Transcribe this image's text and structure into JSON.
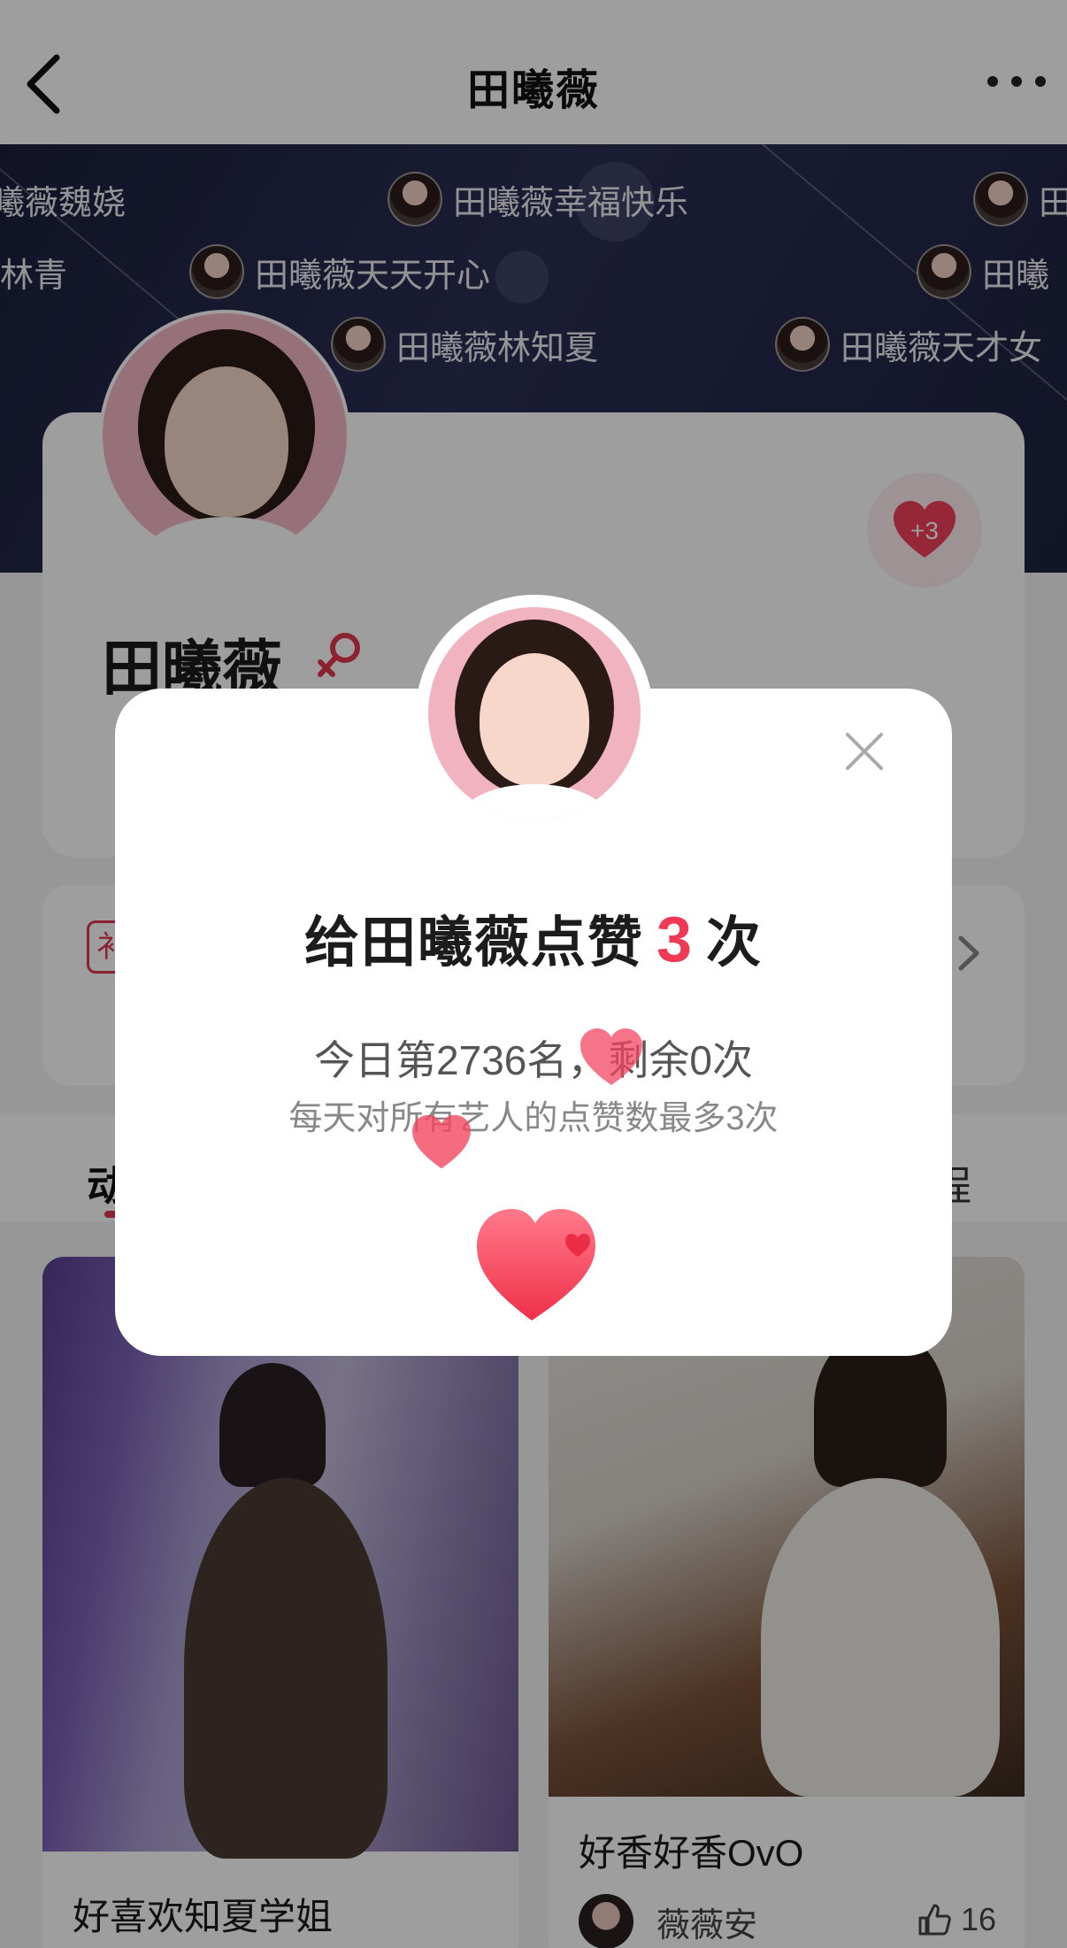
{
  "nav": {
    "title": "田曦薇"
  },
  "banner": {
    "chips": [
      {
        "text": "曦薇魏娆",
        "has_avatar": false
      },
      {
        "text": "田曦薇幸福快乐",
        "has_avatar": true
      },
      {
        "text": "田",
        "has_avatar": true
      },
      {
        "text": "林青",
        "has_avatar": false
      },
      {
        "text": "田曦薇天天开心",
        "has_avatar": true
      },
      {
        "text": "田曦",
        "has_avatar": true
      },
      {
        "text": "田曦薇林知夏",
        "has_avatar": true
      },
      {
        "text": "田曦薇天才女",
        "has_avatar": true
      }
    ]
  },
  "profile": {
    "name": "田曦薇",
    "gender_icon": "female-icon",
    "like_badge": "+3"
  },
  "tabs": {
    "left": "动",
    "right": "程"
  },
  "feed": {
    "posts": [
      {
        "title": "好喜欢知夏学姐"
      },
      {
        "title": "好香好香OvO",
        "author": "薇薇安",
        "likes": "16"
      }
    ]
  },
  "modal": {
    "title_prefix": "给田曦薇点赞",
    "count": "3",
    "title_suffix": "次",
    "rank_text": "今日第2736名，剩余0次",
    "limit_text": "每天对所有艺人的点赞数最多3次",
    "close_icon": "close-icon"
  },
  "colors": {
    "accent": "#f03a55",
    "banner_bg": "#1e2140",
    "overlay": "rgba(0,0,0,0.38)"
  }
}
